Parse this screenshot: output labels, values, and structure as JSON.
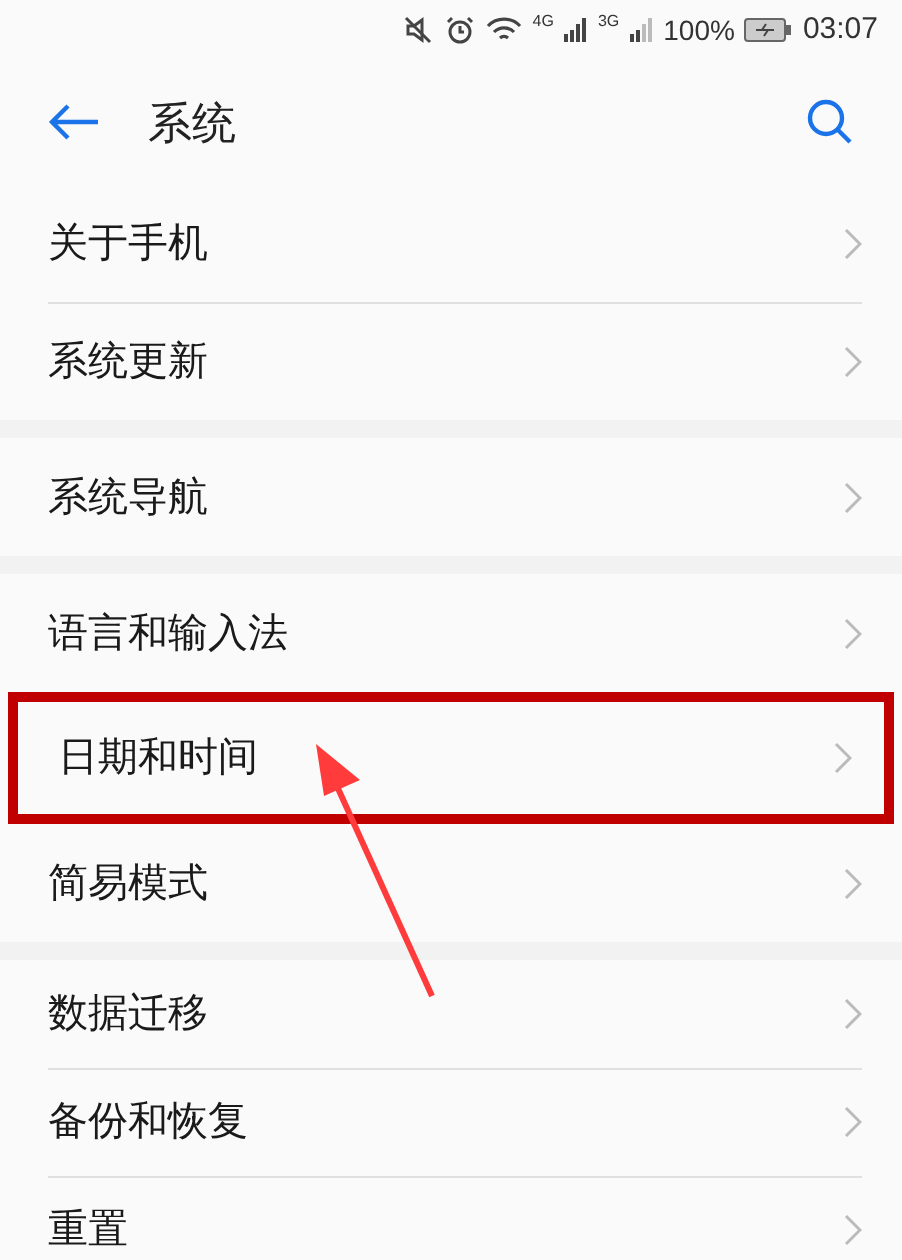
{
  "status_bar": {
    "battery": "100%",
    "time": "03:07",
    "network_1": "4G",
    "network_2": "3G"
  },
  "header": {
    "title": "系统"
  },
  "groups": [
    {
      "items": [
        {
          "label": "关于手机",
          "highlighted": false
        },
        {
          "label": "系统更新",
          "highlighted": false
        }
      ]
    },
    {
      "items": [
        {
          "label": "系统导航",
          "highlighted": false
        }
      ]
    },
    {
      "items": [
        {
          "label": "语言和输入法",
          "highlighted": false
        },
        {
          "label": "日期和时间",
          "highlighted": true
        },
        {
          "label": "简易模式",
          "highlighted": false
        }
      ]
    },
    {
      "items": [
        {
          "label": "数据迁移",
          "highlighted": false
        },
        {
          "label": "备份和恢复",
          "highlighted": false
        },
        {
          "label": "重置",
          "highlighted": false
        }
      ]
    }
  ]
}
